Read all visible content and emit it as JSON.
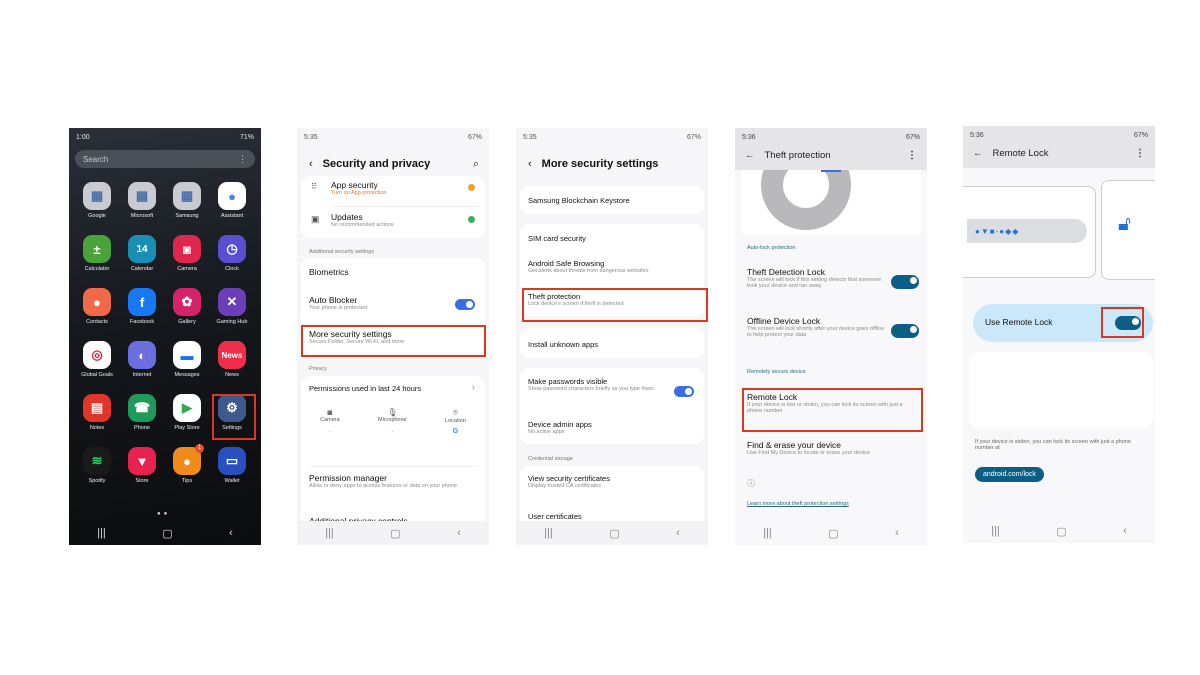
{
  "phone1": {
    "status_time": "1:00",
    "battery": "71%",
    "search_placeholder": "Search",
    "apps": [
      {
        "label": "Google",
        "icon": "folder-icon",
        "color": "#c9cbd0"
      },
      {
        "label": "Microsoft",
        "icon": "folder-icon",
        "color": "#c9cbd0"
      },
      {
        "label": "Samsung",
        "icon": "folder-icon",
        "color": "#c9cbd0"
      },
      {
        "label": "Assistant",
        "icon": "assistant-icon",
        "color": "#ffffff"
      },
      {
        "label": "Calculator",
        "icon": "calculator-icon",
        "color": "#4aa33a"
      },
      {
        "label": "Calendar",
        "icon": "calendar-icon",
        "color": "#1a8fb5"
      },
      {
        "label": "Camera",
        "icon": "camera-icon",
        "color": "#e0264e"
      },
      {
        "label": "Clock",
        "icon": "clock-icon",
        "color": "#5a4fd0"
      },
      {
        "label": "Contacts",
        "icon": "contacts-icon",
        "color": "#f06a4a"
      },
      {
        "label": "Facebook",
        "icon": "facebook-icon",
        "color": "#1877f2"
      },
      {
        "label": "Gallery",
        "icon": "gallery-icon",
        "color": "#d6226a"
      },
      {
        "label": "Gaming Hub",
        "icon": "gaming-hub-icon",
        "color": "#6a3fb8"
      },
      {
        "label": "Global Goals",
        "icon": "global-goals-icon",
        "color": "#ffffff"
      },
      {
        "label": "Internet",
        "icon": "internet-icon",
        "color": "#6a6fe0"
      },
      {
        "label": "Messages",
        "icon": "messages-icon",
        "color": "#ffffff"
      },
      {
        "label": "News",
        "icon": "news-icon",
        "color": "#ef2f4a"
      },
      {
        "label": "Notes",
        "icon": "notes-icon",
        "color": "#e0352b"
      },
      {
        "label": "Phone",
        "icon": "phone-icon",
        "color": "#1f9a5a"
      },
      {
        "label": "Play Store",
        "icon": "play-store-icon",
        "color": "#ffffff"
      },
      {
        "label": "Settings",
        "icon": "gear-icon",
        "color": "#3f5a8a"
      },
      {
        "label": "Spotify",
        "icon": "spotify-icon",
        "color": "#1a1a1a"
      },
      {
        "label": "Store",
        "icon": "store-icon",
        "color": "#e8224e"
      },
      {
        "label": "Tips",
        "icon": "tips-icon",
        "color": "#f08a1a"
      },
      {
        "label": "Wallet",
        "icon": "wallet-icon",
        "color": "#2a4fc0"
      }
    ],
    "calendar_day": "14",
    "news_text": "News",
    "tips_badge": "1",
    "highlighted_app": "Settings"
  },
  "phone2": {
    "status_time": "5:35",
    "battery": "67%",
    "title": "Security and privacy",
    "app_security": {
      "title": "App security",
      "subtitle": "Turn on App protection"
    },
    "updates": {
      "title": "Updates",
      "subtitle": "No recommended actions"
    },
    "section_additional": "Additional security settings",
    "biometrics": "Biometrics",
    "auto_blocker": {
      "title": "Auto Blocker",
      "subtitle": "Your phone is protected",
      "enabled": true
    },
    "more_security": {
      "title": "More security settings",
      "subtitle": "Secure Folder, Secure Wi-Fi, and more"
    },
    "section_privacy": "Privacy",
    "permissions_24h": "Permissions used in last 24 hours",
    "perm_items": [
      {
        "label": "Camera",
        "value": "-"
      },
      {
        "label": "Microphone",
        "value": "-"
      },
      {
        "label": "Location",
        "value": "G"
      }
    ],
    "permission_manager": {
      "title": "Permission manager",
      "subtitle": "Allow or deny apps to access features or data on your phone"
    },
    "additional_privacy": "Additional privacy controls"
  },
  "phone3": {
    "status_time": "5:35",
    "battery": "67%",
    "title": "More security settings",
    "items": [
      {
        "title": "Samsung Blockchain Keystore",
        "subtitle": ""
      },
      {
        "title": "SIM card security",
        "subtitle": ""
      },
      {
        "title": "Android Safe Browsing",
        "subtitle": "Get alerts about threats from dangerous websites"
      },
      {
        "title": "Theft protection",
        "subtitle": "Lock device's screen if theft is detected"
      },
      {
        "title": "Install unknown apps",
        "subtitle": ""
      },
      {
        "title": "Make passwords visible",
        "subtitle": "Show password characters briefly as you type them."
      },
      {
        "title": "Device admin apps",
        "subtitle": "No active apps"
      },
      {
        "title": "View security certificates",
        "subtitle": "Display trusted CA certificates"
      },
      {
        "title": "User certificates",
        "subtitle": ""
      }
    ],
    "section_credential": "Credential storage",
    "passwords_visible_enabled": true
  },
  "phone4": {
    "status_time": "5:36",
    "battery": "67%",
    "title": "Theft protection",
    "section_autolock": "Auto-lock protection",
    "theft_detection": {
      "title": "Theft Detection Lock",
      "subtitle": "The screen will lock if this setting detects that someone took your device and ran away",
      "enabled": true
    },
    "offline_lock": {
      "title": "Offline Device Lock",
      "subtitle": "The screen will lock shortly after your device goes offline to help protect your data",
      "enabled": true
    },
    "section_remote": "Remotely secure device",
    "remote_lock": {
      "title": "Remote Lock",
      "subtitle": "If your device is lost or stolen, you can lock its screen with just a phone number"
    },
    "find_erase": {
      "title": "Find & erase your device",
      "subtitle": "Use Find My Device to locate or erase your device"
    },
    "learn_more": "Learn more about theft protection settings"
  },
  "phone5": {
    "status_time": "5:36",
    "battery": "67%",
    "title": "Remote Lock",
    "use_remote_lock": {
      "label": "Use Remote Lock",
      "enabled": true
    },
    "description": "If your device is stolen, you can lock its screen with just a phone number at",
    "link": "android.com/lock"
  },
  "accent_colors": {
    "highlight": "#d9391f",
    "samsung_toggle": "#3a6fe0",
    "google_toggle": "#0b5f84",
    "google_link": "#2a6e80"
  }
}
